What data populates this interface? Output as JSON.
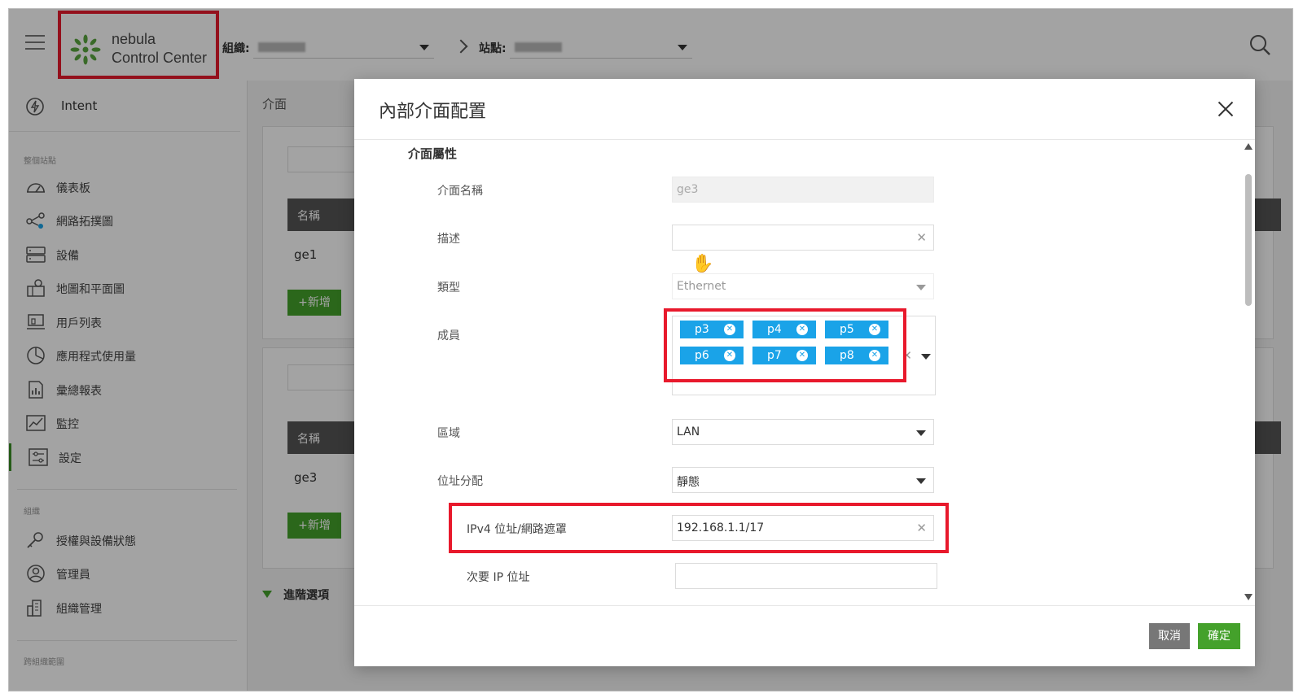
{
  "brand": {
    "line1": "nebula",
    "line2": "Control Center"
  },
  "topbar": {
    "org_label": "組織:",
    "site_label": "站點:"
  },
  "sidebar": {
    "intent_label": "Intent",
    "section1_heading": "整個站點",
    "section1_items": [
      {
        "label": "儀表板",
        "icon": "dashboard-icon"
      },
      {
        "label": "網路拓撲圖",
        "icon": "topology-icon"
      },
      {
        "label": "設備",
        "icon": "devices-icon"
      },
      {
        "label": "地圖和平面圖",
        "icon": "map-icon"
      },
      {
        "label": "用戶列表",
        "icon": "client-list-icon"
      },
      {
        "label": "應用程式使用量",
        "icon": "pie-chart-icon"
      },
      {
        "label": "彙總報表",
        "icon": "report-icon"
      },
      {
        "label": "監控",
        "icon": "monitor-icon"
      },
      {
        "label": "設定",
        "icon": "settings-icon",
        "active": true
      }
    ],
    "section2_heading": "組織",
    "section2_items": [
      {
        "label": "授權與設備狀態",
        "icon": "license-icon"
      },
      {
        "label": "管理員",
        "icon": "admin-icon"
      },
      {
        "label": "組織管理",
        "icon": "org-icon"
      }
    ],
    "section3_heading": "跨組織範圍"
  },
  "background": {
    "title": "介面",
    "table1": {
      "header": "名稱",
      "row": "ge1",
      "add": "+新增"
    },
    "table2": {
      "header": "名稱",
      "row": "ge3",
      "add": "+新增"
    },
    "advanced": "進階選項"
  },
  "modal": {
    "title": "內部介面配置",
    "section": "介面屬性",
    "fields": {
      "name": {
        "label": "介面名稱",
        "value": "ge3"
      },
      "desc": {
        "label": "描述",
        "value": ""
      },
      "type": {
        "label": "類型",
        "value": "Ethernet"
      },
      "members": {
        "label": "成員",
        "tags": [
          "p3",
          "p4",
          "p5",
          "p6",
          "p7",
          "p8"
        ]
      },
      "zone": {
        "label": "區域",
        "value": "LAN"
      },
      "addr": {
        "label": "位址分配",
        "value": "靜態"
      },
      "ipv4": {
        "label": "IPv4 位址/網路遮罩",
        "value": "192.168.1.1/17"
      },
      "secondary": {
        "label": "次要 IP 位址",
        "value": ""
      }
    },
    "cancel": "取消",
    "ok": "確定"
  },
  "colors": {
    "highlight": "#e8192c",
    "tag": "#1aa3e8",
    "primary": "#44a12b"
  }
}
